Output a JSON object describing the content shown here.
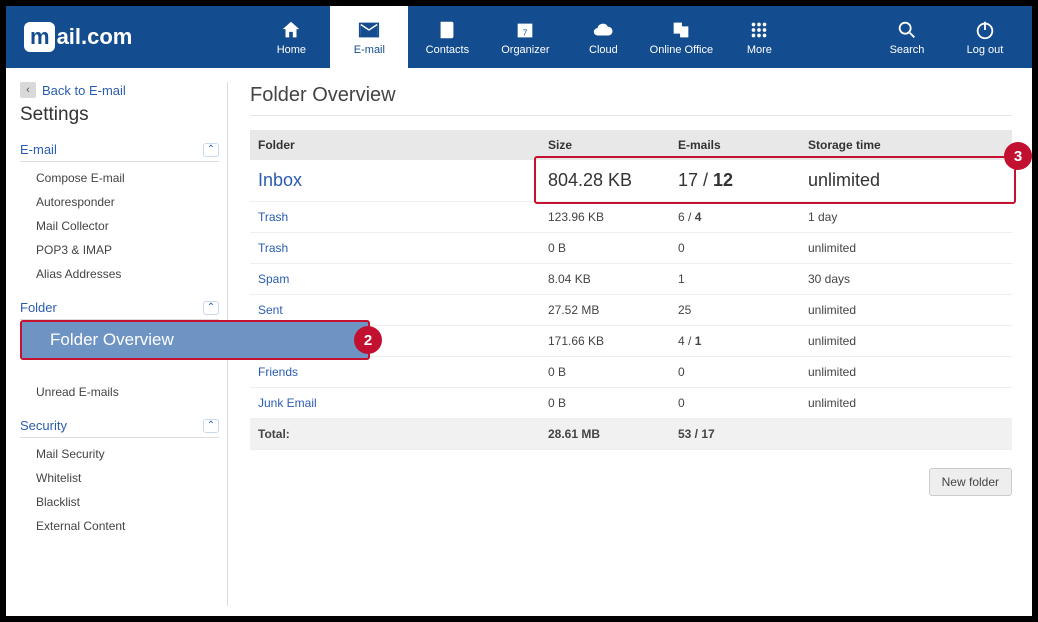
{
  "brand": {
    "box": "m",
    "text": "ail.com"
  },
  "nav": [
    {
      "key": "home",
      "label": "Home"
    },
    {
      "key": "email",
      "label": "E-mail",
      "active": true
    },
    {
      "key": "contacts",
      "label": "Contacts"
    },
    {
      "key": "organizer",
      "label": "Organizer"
    },
    {
      "key": "cloud",
      "label": "Cloud"
    },
    {
      "key": "office",
      "label": "Online Office"
    },
    {
      "key": "more",
      "label": "More"
    },
    {
      "key": "search",
      "label": "Search"
    },
    {
      "key": "logout",
      "label": "Log out"
    }
  ],
  "sidebar": {
    "back_label": "Back to E-mail",
    "settings_title": "Settings",
    "sections": {
      "email": {
        "title": "E-mail",
        "items": [
          "Compose E-mail",
          "Autoresponder",
          "Mail Collector",
          "POP3 & IMAP",
          "Alias Addresses"
        ]
      },
      "folder": {
        "title": "Folder",
        "active_label": "Folder Overview",
        "items_after": [
          "Unread E-mails"
        ]
      },
      "security": {
        "title": "Security",
        "items": [
          "Mail Security",
          "Whitelist",
          "Blacklist",
          "External Content"
        ]
      }
    }
  },
  "page": {
    "title": "Folder Overview",
    "columns": {
      "folder": "Folder",
      "size": "Size",
      "emails": "E-mails",
      "storage": "Storage time"
    },
    "rows": [
      {
        "name": "Inbox",
        "size": "804.28 KB",
        "emails": "17 / 12",
        "storage": "unlimited",
        "highlight": true
      },
      {
        "name": "Trash",
        "size": "123.96 KB",
        "emails": "6 / 4",
        "storage": "1 day"
      },
      {
        "name": "Trash",
        "size": "0 B",
        "emails": "0",
        "storage": "unlimited"
      },
      {
        "name": "Spam",
        "size": "8.04 KB",
        "emails": "1",
        "storage": "30 days"
      },
      {
        "name": "Sent",
        "size": "27.52 MB",
        "emails": "25",
        "storage": "unlimited"
      },
      {
        "name": "",
        "size": "171.66 KB",
        "emails": "4 / 1",
        "storage": "unlimited",
        "covered": true
      },
      {
        "name": "Friends",
        "size": "0 B",
        "emails": "0",
        "storage": "unlimited"
      },
      {
        "name": "Junk Email",
        "size": "0 B",
        "emails": "0",
        "storage": "unlimited"
      }
    ],
    "total": {
      "label": "Total:",
      "size": "28.61 MB",
      "emails": "53 / 17"
    },
    "new_folder_label": "New folder"
  },
  "callouts": {
    "pill": "2",
    "row": "3"
  }
}
